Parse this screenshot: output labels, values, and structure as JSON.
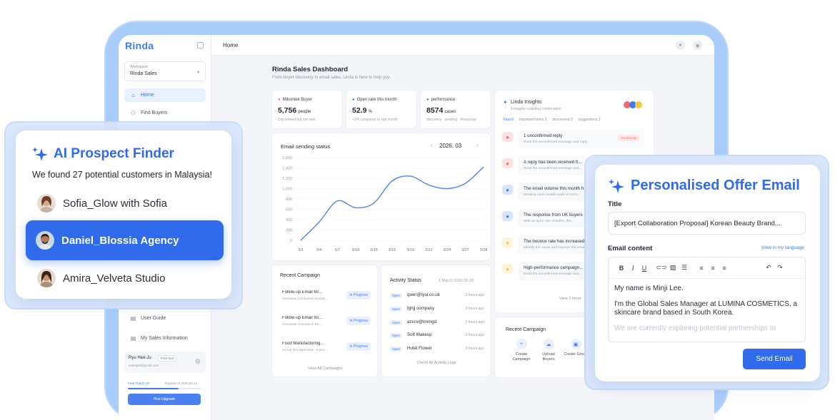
{
  "sidebar": {
    "logo": "Rinda",
    "workspace_label": "Workspace",
    "workspace_name": "Rinda Sales",
    "items": [
      {
        "label": "Home",
        "active": true
      },
      {
        "label": "Find Buyers"
      },
      {
        "label": "User Guide"
      },
      {
        "label": "My Sales Information"
      }
    ],
    "user": {
      "name": "Ryu Hee-Ju",
      "plan_badge": "Free trial",
      "email": "example@gmail.com"
    },
    "trial_label": "Free Trial D-10",
    "trial_expiry": "Expires on 2026.03.13",
    "trial_progress": 0.7,
    "upgrade_label": "Plus Upgrade"
  },
  "topbar": {
    "breadcrumb": "Home"
  },
  "dashboard": {
    "title": "Rinda Sales Dashboard",
    "subtitle": "From buyer discovery to email sales, Linda is here to help you.",
    "stats": [
      {
        "title": "Mikontek Buyer",
        "value": "5,756",
        "unit": "people",
        "sub": "Discovered but not sent"
      },
      {
        "title": "Open rate this month",
        "value": "52.9",
        "unit": "%",
        "sub": "+3% compared to last month"
      },
      {
        "title": "performance",
        "value": "8574",
        "unit": "cases",
        "sub": "discovery · sending · Response"
      }
    ],
    "chart": {
      "title": "Email sending status",
      "month": "2026. 03",
      "prev": "‹",
      "next": "›"
    },
    "recent_campaign": {
      "title": "Recent Campaign",
      "rows": [
        {
          "name": "Follow-up Email for...",
          "desc": "Overseas Consumer Goods...",
          "status": "In Progress"
        },
        {
          "name": "Follow-up Email for...",
          "desc": "Overseas Cosmetics Re...",
          "status": "In Progress"
        },
        {
          "name": "Food Manufacturing...",
          "desc": "Group Not Specified · 0 peo...",
          "status": "In Progress"
        }
      ],
      "link": "View All Campaigns"
    },
    "activity": {
      "title": "Activity Status",
      "date": "1 March 2026 00:39",
      "rows": [
        {
          "tag": "Open",
          "name": "qwer@tyui.co.uk",
          "time": "3 hours ago"
        },
        {
          "tag": "Open",
          "name": "fghjj company",
          "time": "3 hours ago"
        },
        {
          "tag": "Open",
          "name": "azxcv@bnmgd",
          "time": "3 hours ago"
        },
        {
          "tag": "Open",
          "name": "Soft Makeup",
          "time": "3 hours ago"
        },
        {
          "tag": "Open",
          "name": "Hotel Flower",
          "time": "3 hours ago"
        }
      ],
      "link": "Check All Activity Logs"
    },
    "insights": {
      "title": "Linda Insights",
      "sub": "8 insights requiring confirmation",
      "tabs": [
        "Total 8",
        "Important items 2",
        "discovered 3",
        "suggestions 3"
      ],
      "rows": [
        {
          "title": "1 unconfirmed reply",
          "desc": "Read the unconfirmed message and reply...",
          "badge": "Go directly",
          "color": "#f26b6b"
        },
        {
          "title": "A reply has been received fr...",
          "desc": "Read the unconfirmed message and...",
          "color": "#f26b6b"
        },
        {
          "title": "The email volume this month h...",
          "desc": "Sending more emails leads to more...",
          "color": "#3f7bf3"
        },
        {
          "title": "The response from UK buyers ...",
          "desc": "With an open rate of 300%, the...",
          "color": "#3f7bf3"
        },
        {
          "title": "The bounce rate has increased",
          "desc": "Identify the cause and improve the email content!",
          "color": "#f7c744"
        },
        {
          "title": "High-performance campaign...",
          "desc": "Read the unconfirmed message and...",
          "color": "#f7c744"
        }
      ],
      "link": "View 2 more"
    },
    "recent_campaign_2": {
      "title": "Recent Campaign",
      "actions": [
        "Create Campaign",
        "Upload Buyers",
        "Create Group"
      ]
    }
  },
  "chart_data": {
    "type": "line",
    "title": "Email sending status",
    "x": [
      "3/1",
      "3/4",
      "3/7",
      "3/10",
      "3/13",
      "3/16",
      "3/19",
      "3/21",
      "3/24",
      "3/27",
      "3/28"
    ],
    "y_ticks": [
      0,
      200,
      400,
      600,
      800,
      1000,
      1200,
      1400,
      1600
    ],
    "y_tick_labels": [
      "0",
      "200",
      "400",
      "600",
      "800",
      "1,000",
      "1,200",
      "1,400",
      "1,600"
    ],
    "values": [
      0,
      350,
      760,
      630,
      720,
      1150,
      1240,
      1070,
      1000,
      1100,
      1420
    ],
    "ylim": [
      0,
      1600
    ],
    "color": "#4b86f2",
    "grid": true
  },
  "finder": {
    "title": "AI Prospect Finder",
    "subtitle": "We found 27 potential customers in Malaysia!",
    "prospects": [
      {
        "name": "Sofia_Glow with Sofia",
        "selected": false
      },
      {
        "name": "Daniel_Blossia Agency",
        "selected": true
      },
      {
        "name": "Amira_Velveta Studio",
        "selected": false
      }
    ]
  },
  "email": {
    "title": "Personalised Offer Email",
    "title_label": "Title",
    "subject": "[Export Collaboration Proposal] Korean Beauty Brand...",
    "content_label": "Email content",
    "language_link": "View in my language",
    "body": [
      "My name is Minji Lee.",
      "I'm the Global Sales Manager at LUMINA COSMETICS, a skincare brand based in South Korea.",
      "We are currently exploring potential partnerships to"
    ],
    "send_label": "Send Email",
    "brand_color": "#2f6bea"
  }
}
